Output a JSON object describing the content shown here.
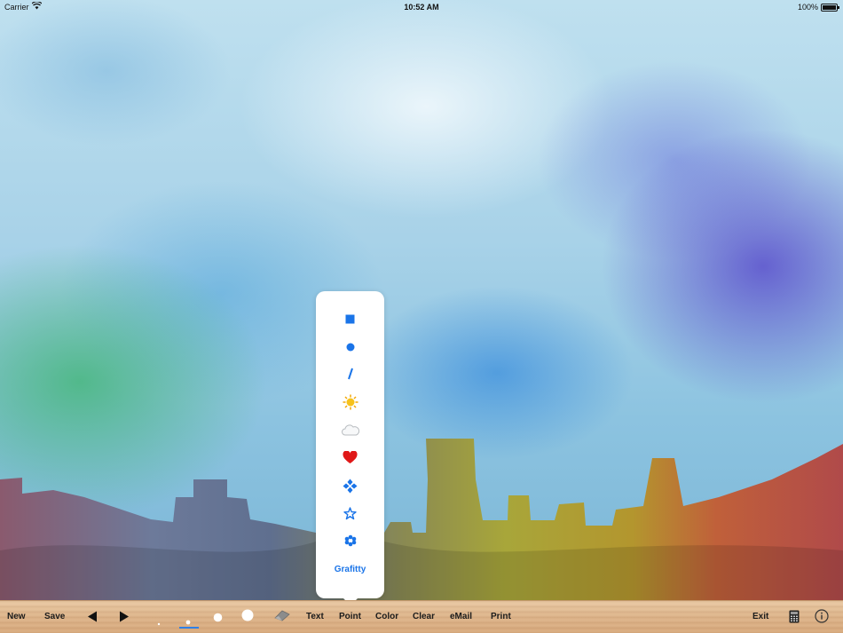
{
  "status_bar": {
    "carrier": "Carrier",
    "time": "10:52 AM",
    "battery": "100%"
  },
  "popover": {
    "title_hidden": "",
    "items": [
      {
        "icon": "square-icon",
        "color": "#1a74e8"
      },
      {
        "icon": "circle-icon",
        "color": "#1a74e8"
      },
      {
        "icon": "slash-icon",
        "color": "#1a74e8"
      },
      {
        "icon": "sun-icon",
        "color": "#f2b705"
      },
      {
        "icon": "cloud-icon",
        "color": "#c8ccd0"
      },
      {
        "icon": "heart-icon",
        "color": "#e01818"
      },
      {
        "icon": "diamond-cluster-icon",
        "color": "#1a74e8"
      },
      {
        "icon": "star-icon",
        "color": "#1a74e8"
      },
      {
        "icon": "snowflake-icon",
        "color": "#1a74e8"
      }
    ],
    "grafitty_label": "Grafitty"
  },
  "toolbar": {
    "new_label": "New",
    "save_label": "Save",
    "text_label": "Text",
    "point_label": "Point",
    "color_label": "Color",
    "clear_label": "Clear",
    "email_label": "eMail",
    "print_label": "Print",
    "exit_label": "Exit",
    "selected_brush_size": 2
  }
}
